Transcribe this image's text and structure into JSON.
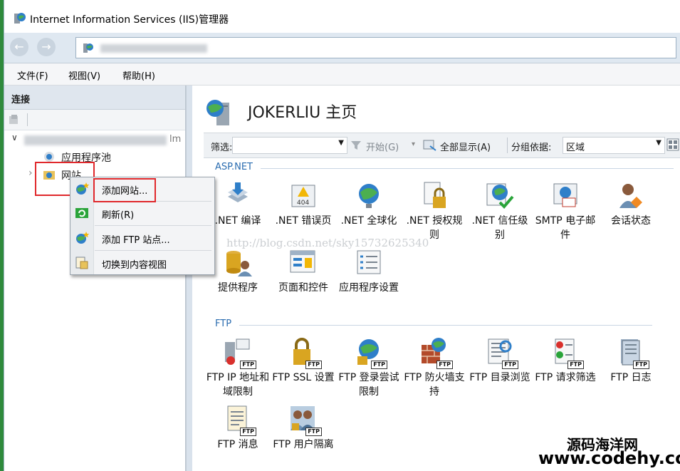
{
  "window": {
    "title": "Internet Information Services (IIS)管理器"
  },
  "nav": {
    "back": "←",
    "forward": "→"
  },
  "menu": [
    "文件(F)",
    "视图(V)",
    "帮助(H)"
  ],
  "connections": {
    "header": "连接",
    "tree": {
      "expander": "∨",
      "collapsed": "›",
      "app_pools": "应用程序池",
      "sites": "网站"
    }
  },
  "main": {
    "title": "JOKERLIU 主页",
    "filter": {
      "label": "筛选:",
      "start": "开始(G)",
      "show_all": "全部显示(A)",
      "group_by_label": "分组依据:",
      "group_by_value": "区域"
    },
    "groups": [
      {
        "name": "ASP.NET",
        "features": [
          {
            "label": ".NET 编译",
            "icon": "dotnet-compile-icon"
          },
          {
            "label": ".NET 错误页",
            "icon": "error-page-icon"
          },
          {
            "label": ".NET 全球化",
            "icon": "globe-icon"
          },
          {
            "label": ".NET 授权规则",
            "icon": "authorization-icon"
          },
          {
            "label": ".NET 信任级别",
            "icon": "trust-level-icon"
          },
          {
            "label": "SMTP 电子邮件",
            "icon": "smtp-email-icon"
          },
          {
            "label": "会话状态",
            "icon": "session-state-icon"
          },
          {
            "label": "提供程序",
            "icon": "providers-icon"
          },
          {
            "label": "页面和控件",
            "icon": "pages-controls-icon"
          },
          {
            "label": "应用程序设置",
            "icon": "app-settings-icon"
          }
        ]
      },
      {
        "name": "FTP",
        "features": [
          {
            "label": "FTP IP 地址和域限制",
            "icon": "ftp-ip-icon"
          },
          {
            "label": "FTP SSL 设置",
            "icon": "ftp-ssl-icon"
          },
          {
            "label": "FTP 登录尝试限制",
            "icon": "ftp-logon-icon"
          },
          {
            "label": "FTP 防火墙支持",
            "icon": "ftp-firewall-icon"
          },
          {
            "label": "FTP 目录浏览",
            "icon": "ftp-directory-icon"
          },
          {
            "label": "FTP 请求筛选",
            "icon": "ftp-request-filter-icon"
          },
          {
            "label": "FTP 日志",
            "icon": "ftp-log-icon"
          },
          {
            "label": "FTP 消息",
            "icon": "ftp-message-icon"
          },
          {
            "label": "FTP 用户隔离",
            "icon": "ftp-user-isolation-icon"
          }
        ],
        "badge": "FTP"
      }
    ]
  },
  "context_menu": [
    "添加网站...",
    "刷新(R)",
    "添加 FTP 站点...",
    "切换到内容视图"
  ],
  "watermark": "http://blog.csdn.net/sky15732625340",
  "brand": {
    "line1": "源码海洋网",
    "line2": "www.codehy.com"
  },
  "colors": {
    "accent": "#2a6cb0",
    "highlight": "#e0282c"
  }
}
